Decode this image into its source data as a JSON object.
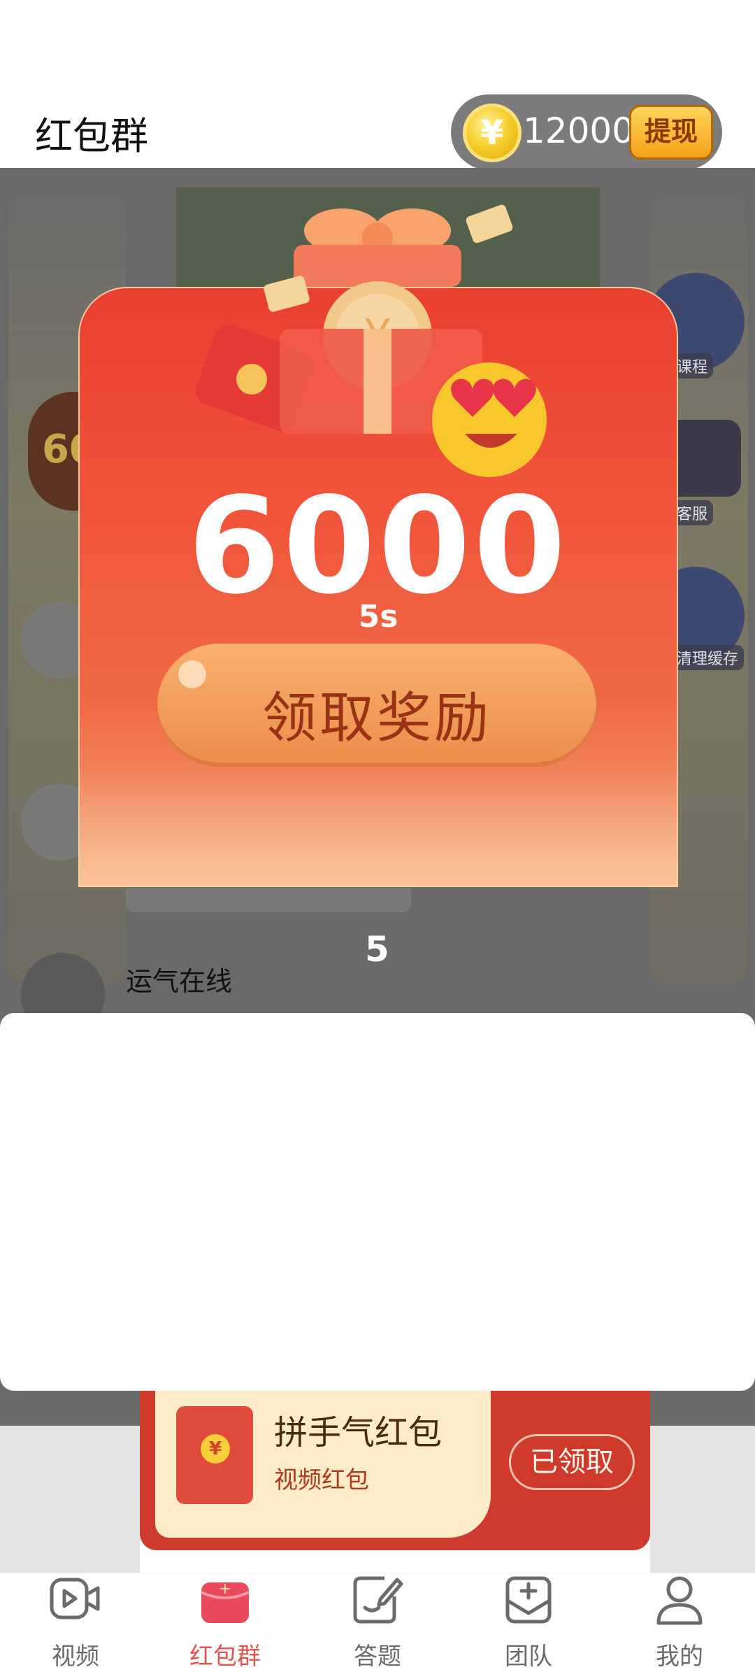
{
  "header": {
    "title": "红包群",
    "coins": "12000",
    "coin_symbol": "¥",
    "withdraw_label": "提现"
  },
  "background": {
    "badge_text": "60",
    "side_labels": [
      "课程",
      "客服",
      "清理缓存"
    ],
    "count_text": "5",
    "user_name": "运气在线"
  },
  "modal": {
    "amount": "6000",
    "countdown": "5s",
    "claim_label": "领取奖励"
  },
  "packet_card": {
    "title": "拼手气红包",
    "subtitle": "视频红包",
    "status_label": "已领取",
    "coin_symbol": "¥"
  },
  "nav": {
    "items": [
      {
        "label": "视频",
        "icon": "video-icon"
      },
      {
        "label": "红包群",
        "icon": "red-packet-icon"
      },
      {
        "label": "答题",
        "icon": "quiz-icon"
      },
      {
        "label": "团队",
        "icon": "team-icon"
      },
      {
        "label": "我的",
        "icon": "profile-icon"
      }
    ],
    "active_index": 1,
    "active_color": "#e2544e",
    "inactive_color": "#6b6b6b"
  },
  "colors": {
    "modal_red": "#ea3f2f",
    "claim_orange": "#f8b16d",
    "coin_gold": "#f7d031",
    "overlay_gray": "#6a6a6a"
  }
}
